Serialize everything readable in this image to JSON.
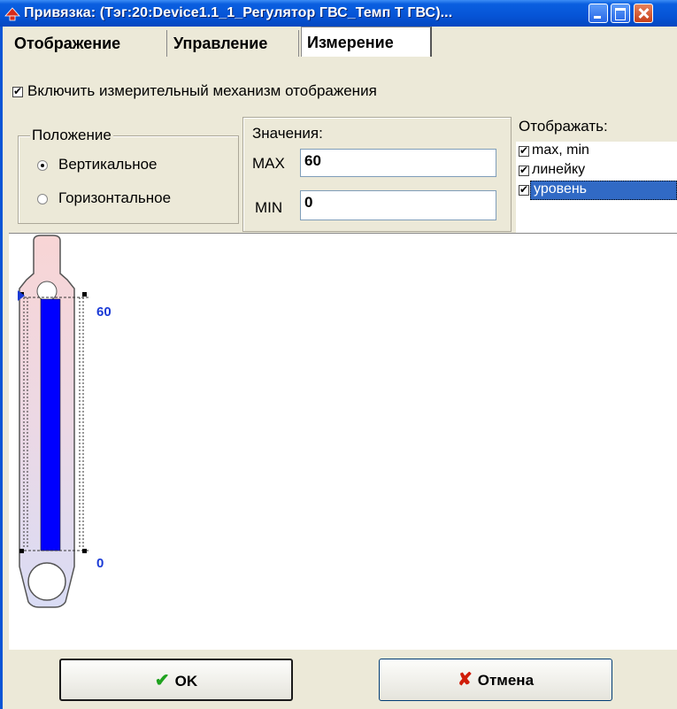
{
  "window": {
    "title": "Привязка: (Тэг:20:Device1.1_1_Регулятор ГВС_Темп Т ГВС)..."
  },
  "tabs": [
    {
      "label": "Отображение"
    },
    {
      "label": "Управление"
    },
    {
      "label": "Измерение",
      "active": true
    }
  ],
  "enable_checkbox": {
    "label": "Включить измерительный механизм отображения",
    "checked": true
  },
  "position_group": {
    "title": "Положение",
    "options": [
      {
        "label": "Вертикальное",
        "selected": true
      },
      {
        "label": "Горизонтальное",
        "selected": false
      }
    ]
  },
  "values_group": {
    "title": "Значения:",
    "max_label": "MAX",
    "max_value": "60",
    "min_label": "MIN",
    "min_value": "0"
  },
  "display_group": {
    "title": "Отображать:",
    "items": [
      {
        "label": "max, min",
        "checked": true
      },
      {
        "label": "линейку",
        "checked": true
      },
      {
        "label": "уровень",
        "checked": true,
        "selected": true
      }
    ]
  },
  "preview": {
    "max_tick": "60",
    "min_tick": "0",
    "colors": {
      "bulb_top": "#f8d5d5",
      "bulb_bottom": "#d9dcf5",
      "level": "#0000ff",
      "tick": "#1a3ad6"
    }
  },
  "buttons": {
    "ok_label": "OK",
    "cancel_label": "Отмена"
  }
}
